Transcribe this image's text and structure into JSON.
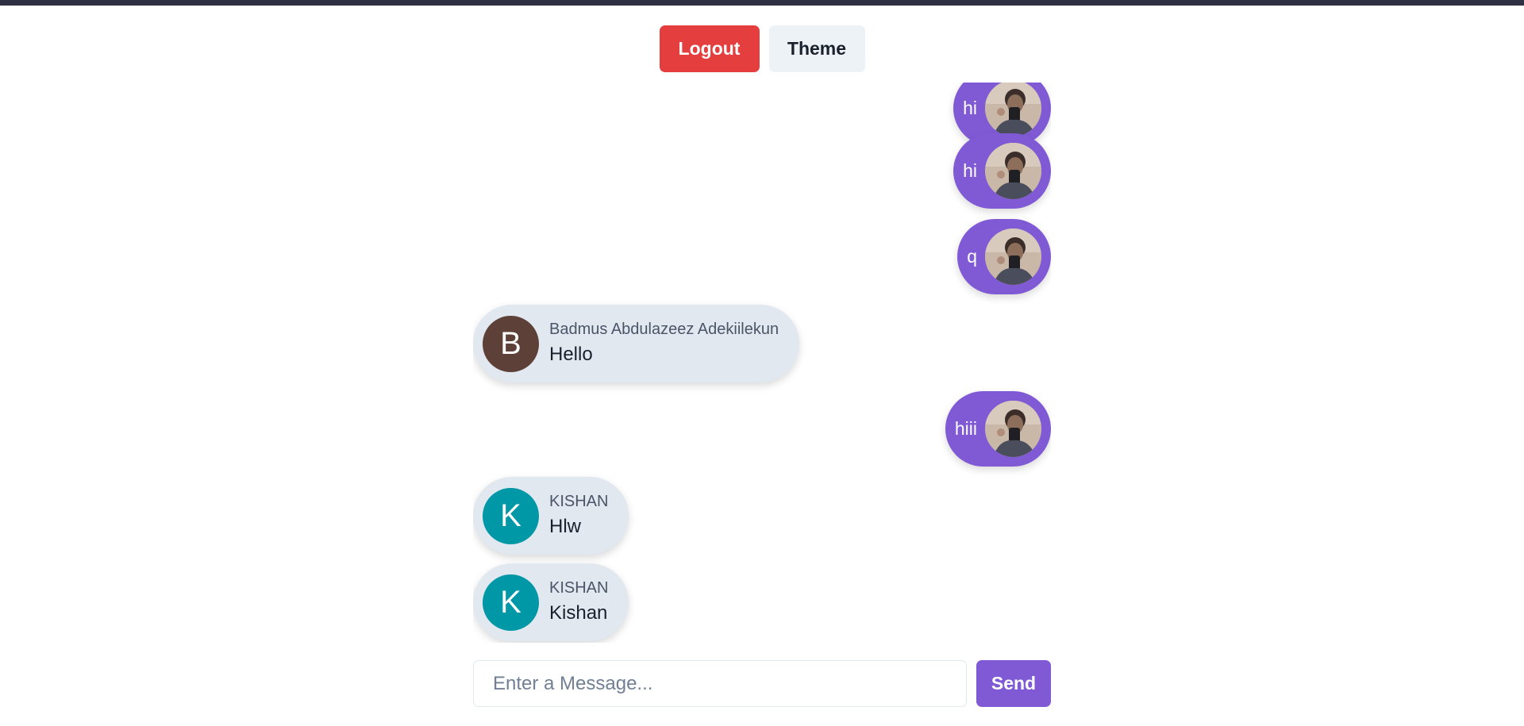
{
  "header": {
    "logout_label": "Logout",
    "theme_label": "Theme"
  },
  "colors": {
    "topbar": "#2d3142",
    "logout": "#e53e3e",
    "sent_bubble": "#805ad5",
    "received_bubble": "#e2e8f0",
    "avatar_b": "#5d4037",
    "avatar_k": "#0097a7"
  },
  "messages": [
    {
      "direction": "sent",
      "text": "hi",
      "icon": "user-photo-icon"
    },
    {
      "direction": "sent",
      "text": "hi",
      "icon": "user-photo-icon"
    },
    {
      "direction": "sent",
      "text": "q",
      "icon": "user-photo-icon"
    },
    {
      "direction": "received",
      "sender": "Badmus Abdulazeez Adekiilekun",
      "initial": "B",
      "text": "Hello"
    },
    {
      "direction": "sent",
      "text": "hiii",
      "icon": "user-photo-icon"
    },
    {
      "direction": "received",
      "sender": "KISHAN",
      "initial": "K",
      "text": "Hlw"
    },
    {
      "direction": "received",
      "sender": "KISHAN",
      "initial": "K",
      "text": "Kishan"
    }
  ],
  "composer": {
    "placeholder": "Enter a Message...",
    "value": "",
    "send_label": "Send"
  }
}
